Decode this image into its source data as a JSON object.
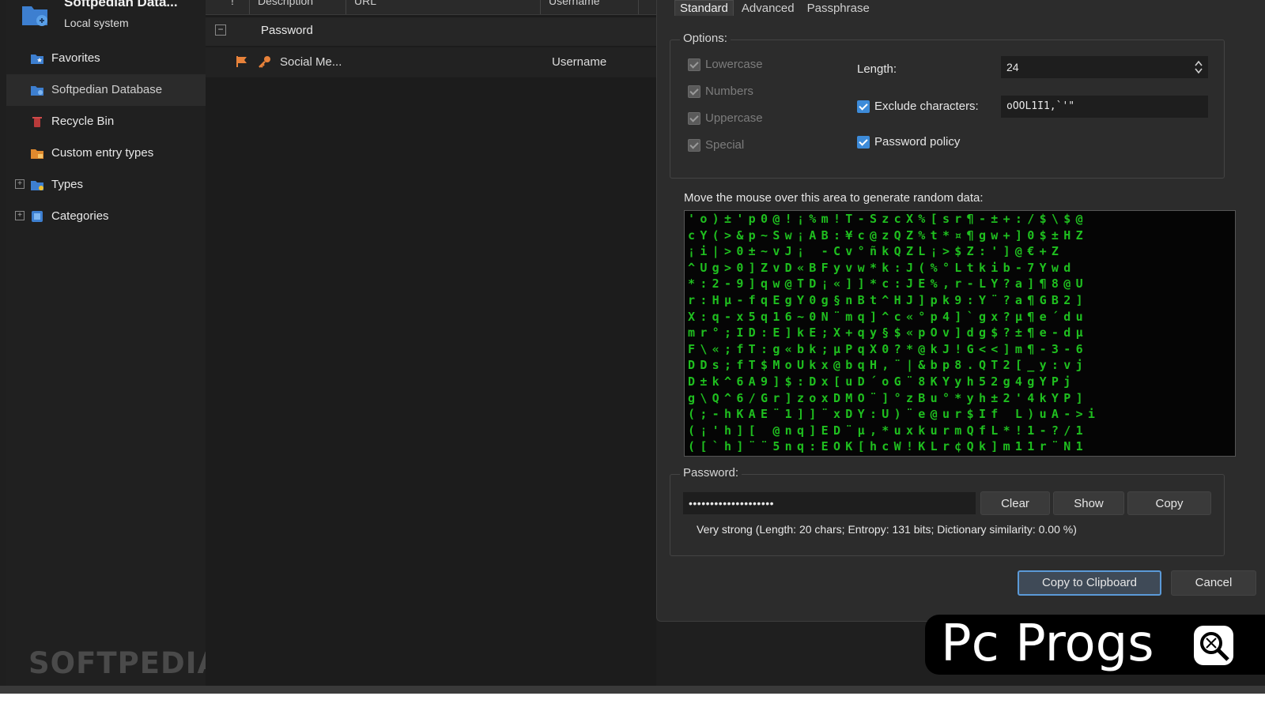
{
  "sidebar": {
    "db_title": "Softpedian Data...",
    "db_subtitle": "Local system",
    "items": [
      {
        "label": "Favorites",
        "icon": "folder-star-icon"
      },
      {
        "label": "Softpedian Database",
        "icon": "folder-database-icon"
      },
      {
        "label": "Recycle Bin",
        "icon": "recycle-bin-icon"
      },
      {
        "label": "Custom entry types",
        "icon": "folder-orange-icon"
      },
      {
        "label": "Types",
        "icon": "folder-tag-icon"
      },
      {
        "label": "Categories",
        "icon": "categories-icon"
      }
    ],
    "watermark": "SOFTPEDIA"
  },
  "list": {
    "columns": [
      "!",
      "Description",
      "URL",
      "Username"
    ],
    "group_label": "Password",
    "entry": {
      "description": "Social Me...",
      "username": "Username"
    }
  },
  "dialog": {
    "tabs": [
      "Standard",
      "Advanced",
      "Passphrase"
    ],
    "options_legend": "Options:",
    "checks": [
      {
        "label": "Lowercase",
        "checked": true,
        "enabled": false
      },
      {
        "label": "Numbers",
        "checked": true,
        "enabled": false
      },
      {
        "label": "Uppercase",
        "checked": true,
        "enabled": false
      },
      {
        "label": "Special",
        "checked": true,
        "enabled": false
      }
    ],
    "length_label": "Length:",
    "length_value": "24",
    "exclude_label": "Exclude characters:",
    "exclude_value": "oOOL1I1,`'\"",
    "policy_label": "Password policy",
    "mouse_label": "Move the mouse over this area to generate random data:",
    "random_rows": [
      "'o)±'p0@!¡%m!T-SzcX%[sr¶-±+:/$\\$@",
      "cY(>&p~Sw¡AB:¥c@zQZ%t*¤¶gw+]0$±HZ",
      "¡i|>0±~vJ¡ -Cv°ñkQZL¡>$Z:']@€+Z ",
      "^Ug>0]ZvD«BFyvw*k:J(%°Ltkib-7Ywd",
      "*:2-9]qw@TD¡«]]*c:JE%,r-LY?a]¶8@U",
      "r:Hµ-fqEgY0g§nBt^HJ]pk9:Y¨?a¶GB2]",
      "X:q-x5q16~0N¨mq]^c«°p4]`gx?µ¶e´du",
      "mr°;ID:E]kE;X+qy§$«pOv]dg$?±¶e-dµ",
      "F\\«;fT:g«bk;µPqX0?*@kJ!G<<]m¶-3-6",
      "DDs;fT$MoUkx@bqH,¨|&bp8.QT2[_y:vj",
      "D±k^6A9]$:Dx[uD´oG¨8KYyh52g4gYPj",
      "g\\Q^6/Gr]zoxDMO¨]°zBu°*yh±2'4kYP]",
      "(;-hKAE¨1]]¨xDY:U)¨e@ur$If L)uA->i",
      "(¡'h][ @nq]ED¨µ,*uxkurmQfL*!1-?/1",
      "([`h]¨¨5nq:EOK[hcW!KLr¢Qk]m11r¨N1"
    ],
    "password_legend": "Password:",
    "password_mask": "••••••••••••••••••••",
    "clear_label": "Clear",
    "show_label": "Show",
    "copy_label": "Copy",
    "strength_text": "Very strong (Length: 20 chars; Entropy: 131 bits; Dictionary similarity: 0.00 %)",
    "copy_clipboard_label": "Copy to Clipboard",
    "cancel_label": "Cancel"
  },
  "overlay": {
    "brand_text": "Pc Progs",
    "brand_icon": "magnifier-icon"
  }
}
